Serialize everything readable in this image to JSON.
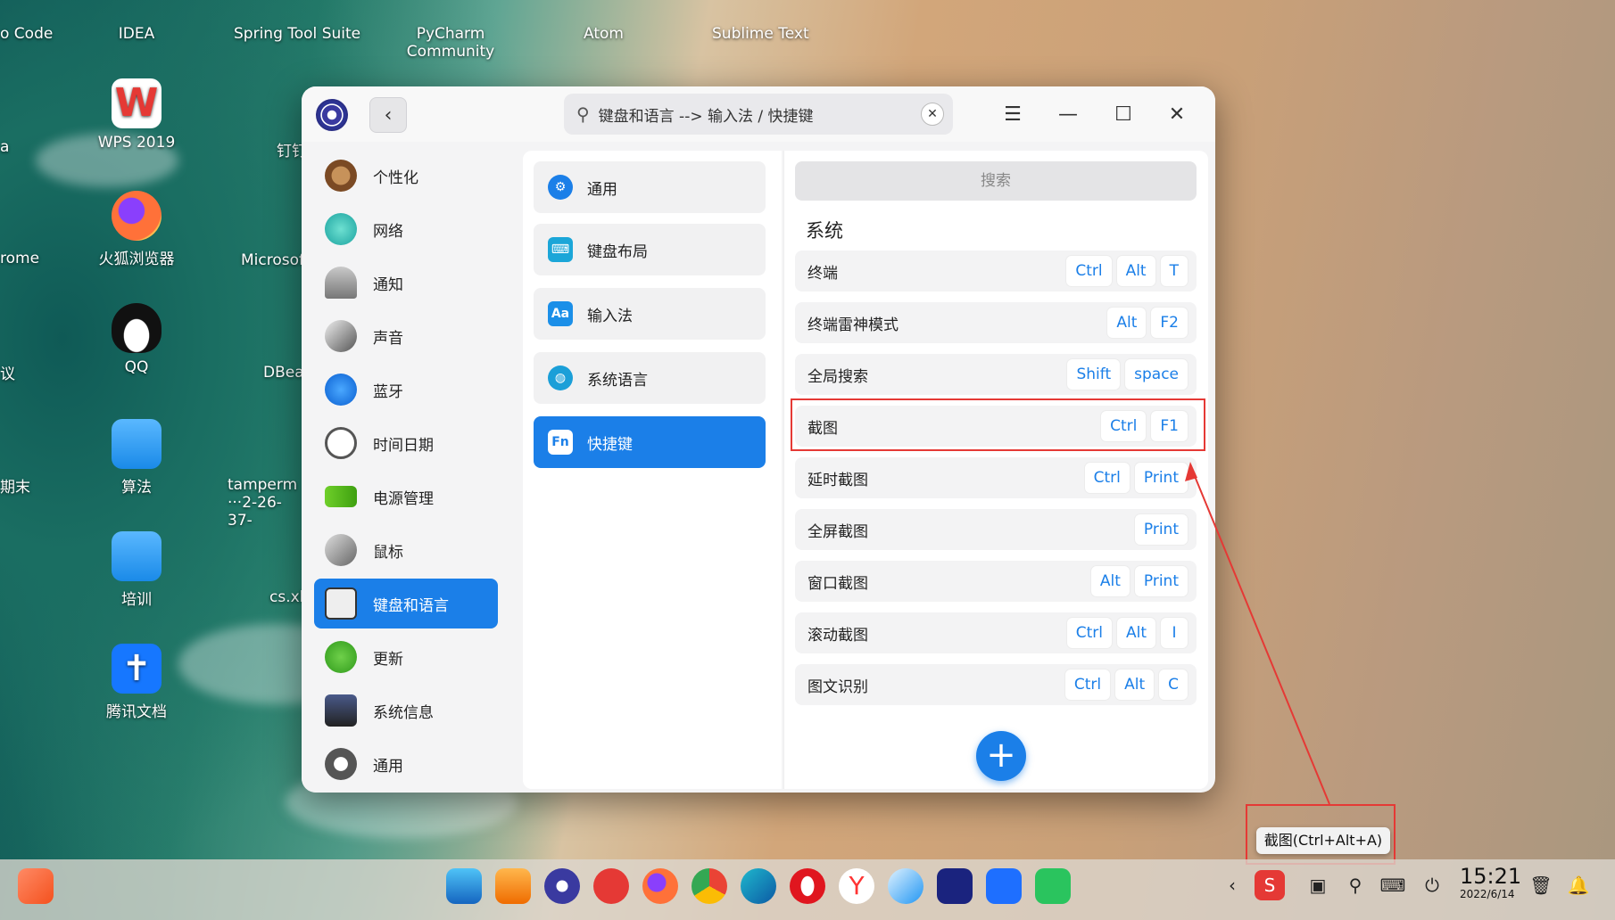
{
  "desktop": {
    "icons": [
      {
        "label": "o Code"
      },
      {
        "label": "IDEA"
      },
      {
        "label": "Spring Tool Suite"
      },
      {
        "label": "PyCharm Community"
      },
      {
        "label": "Atom"
      },
      {
        "label": "Sublime Text"
      },
      {
        "label": "a"
      },
      {
        "label": "WPS 2019"
      },
      {
        "label": "钉钉"
      },
      {
        "label": "rome"
      },
      {
        "label": "火狐浏览器"
      },
      {
        "label": "Microsof"
      },
      {
        "label": "议"
      },
      {
        "label": "QQ"
      },
      {
        "label": "DBea"
      },
      {
        "label": "期末"
      },
      {
        "label": "算法"
      },
      {
        "label": "tamperm ···2-26-37-"
      },
      {
        "label": "培训"
      },
      {
        "label": "cs.xl"
      },
      {
        "label": "腾讯文档"
      }
    ]
  },
  "window": {
    "search_text": "键盘和语言 --> 输入法 / 快捷键",
    "nav_items": [
      {
        "label": "个性化"
      },
      {
        "label": "网络"
      },
      {
        "label": "通知"
      },
      {
        "label": "声音"
      },
      {
        "label": "蓝牙"
      },
      {
        "label": "时间日期"
      },
      {
        "label": "电源管理"
      },
      {
        "label": "鼠标"
      },
      {
        "label": "键盘和语言"
      },
      {
        "label": "更新"
      },
      {
        "label": "系统信息"
      },
      {
        "label": "通用"
      }
    ],
    "sub_items": [
      {
        "label": "通用"
      },
      {
        "label": "键盘布局"
      },
      {
        "label": "输入法"
      },
      {
        "label": "系统语言"
      },
      {
        "label": "快捷键"
      }
    ],
    "shortcut_search_placeholder": "搜索",
    "section_title": "系统",
    "shortcuts": [
      {
        "name": "终端",
        "keys": [
          "Ctrl",
          "Alt",
          "T"
        ]
      },
      {
        "name": "终端雷神模式",
        "keys": [
          "Alt",
          "F2"
        ]
      },
      {
        "name": "全局搜索",
        "keys": [
          "Shift",
          "space"
        ]
      },
      {
        "name": "截图",
        "keys": [
          "Ctrl",
          "F1"
        ]
      },
      {
        "name": "延时截图",
        "keys": [
          "Ctrl",
          "Print"
        ]
      },
      {
        "name": "全屏截图",
        "keys": [
          "Print"
        ]
      },
      {
        "name": "窗口截图",
        "keys": [
          "Alt",
          "Print"
        ]
      },
      {
        "name": "滚动截图",
        "keys": [
          "Ctrl",
          "Alt",
          "I"
        ]
      },
      {
        "name": "图文识别",
        "keys": [
          "Ctrl",
          "Alt",
          "C"
        ]
      }
    ],
    "add_label": "+"
  },
  "tooltip": "截图(Ctrl+Alt+A)",
  "clock": {
    "time": "15:21",
    "date": "2022/6/14"
  },
  "colors": {
    "accent": "#1b7fe8",
    "annotation": "#e53935"
  }
}
